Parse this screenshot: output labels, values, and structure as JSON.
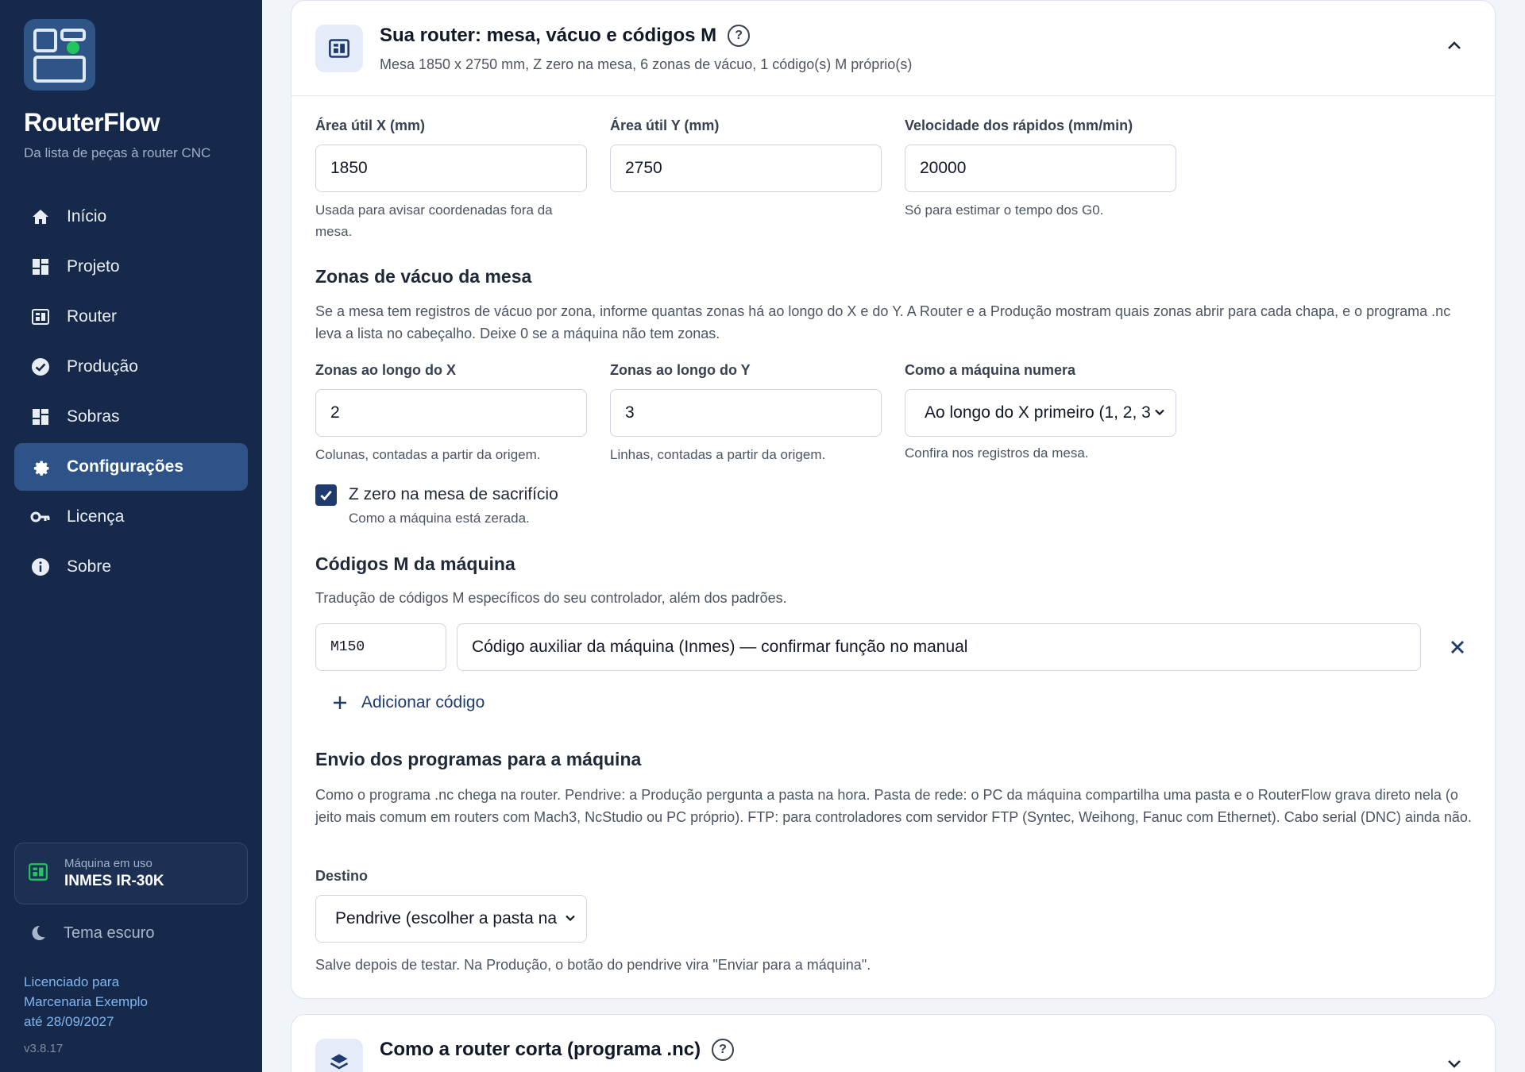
{
  "sidebar": {
    "app_name": "RouterFlow",
    "tagline": "Da lista de peças à router CNC",
    "nav": [
      {
        "label": "Início",
        "icon": "home-icon"
      },
      {
        "label": "Projeto",
        "icon": "dashboard-icon"
      },
      {
        "label": "Router",
        "icon": "router-icon"
      },
      {
        "label": "Produção",
        "icon": "check-circle-icon"
      },
      {
        "label": "Sobras",
        "icon": "grid-icon"
      },
      {
        "label": "Configurações",
        "icon": "gear-icon",
        "active": true
      },
      {
        "label": "Licença",
        "icon": "key-icon"
      },
      {
        "label": "Sobre",
        "icon": "info-icon"
      }
    ],
    "machine": {
      "label": "Máquina em uso",
      "name": "INMES IR-30K"
    },
    "theme_toggle": "Tema escuro",
    "license": {
      "line1": "Licenciado para",
      "line2": "Marcenaria Exemplo",
      "line3": "até 28/09/2027"
    },
    "version": "v3.8.17"
  },
  "router_card": {
    "title": "Sua router: mesa, vácuo e códigos M",
    "help": "?",
    "subtitle": "Mesa 1850 x 2750 mm, Z zero na mesa, 6 zonas de vácuo, 1 código(s) M próprio(s)",
    "area_x": {
      "label": "Área útil X (mm)",
      "value": "1850",
      "help": "Usada para avisar coordenadas fora da mesa."
    },
    "area_y": {
      "label": "Área útil Y (mm)",
      "value": "2750"
    },
    "rapid_speed": {
      "label": "Velocidade dos rápidos (mm/min)",
      "value": "20000",
      "help": "Só para estimar o tempo dos G0."
    },
    "vacuum": {
      "title": "Zonas de vácuo da mesa",
      "description": "Se a mesa tem registros de vácuo por zona, informe quantas zonas há ao longo do X e do Y. A Router e a Produção mostram quais zonas abrir para cada chapa, e o programa .nc leva a lista no cabeçalho. Deixe 0 se a máquina não tem zonas.",
      "zones_x": {
        "label": "Zonas ao longo do X",
        "value": "2",
        "help": "Colunas, contadas a partir da origem."
      },
      "zones_y": {
        "label": "Zonas ao longo do Y",
        "value": "3",
        "help": "Linhas, contadas a partir da origem."
      },
      "numbering": {
        "label": "Como a máquina numera",
        "value": "Ao longo do X primeiro (1, 2, 3",
        "help": "Confira nos registros da mesa."
      }
    },
    "z_zero": {
      "checked": true,
      "label": "Z zero na mesa de sacrifício",
      "help": "Como a máquina está zerada."
    },
    "mcodes": {
      "title": "Códigos M da máquina",
      "description": "Tradução de códigos M específicos do seu controlador, além dos padrões.",
      "rows": [
        {
          "code": "M150",
          "description": "Código auxiliar da máquina (Inmes) — confirmar função no manual"
        }
      ],
      "add_label": "Adicionar código"
    },
    "send": {
      "title": "Envio dos programas para a máquina",
      "description": "Como o programa .nc chega na router. Pendrive: a Produção pergunta a pasta na hora. Pasta de rede: o PC da máquina compartilha uma pasta e o RouterFlow grava direto nela (o jeito mais comum em routers com Mach3, NcStudio ou PC próprio). FTP: para controladores com servidor FTP (Syntec, Weihong, Fanuc com Ethernet). Cabo serial (DNC) ainda não.",
      "destination_label": "Destino",
      "destination_value": "Pendrive (escolher a pasta na",
      "footer": "Salve depois de testar. Na Produção, o botão do pendrive vira \"Enviar para a máquina\"."
    }
  },
  "program_card": {
    "title": "Como a router corta (programa .nc)",
    "help": "?"
  },
  "colors": {
    "sidebar": "#16294a",
    "active": "#2d5389",
    "accent": "#1e3a6e",
    "checkbox": "#1e3a6e",
    "machine_icon": "#22c55e"
  }
}
